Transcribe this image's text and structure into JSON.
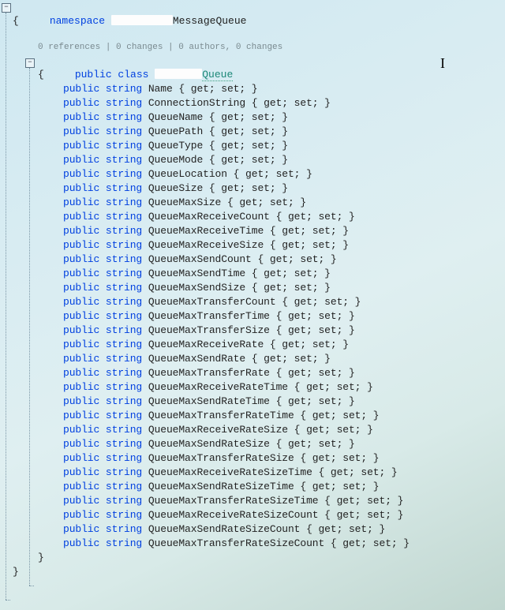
{
  "header": {
    "namespace_kw": "namespace",
    "namespace_suffix": "MessageQueue"
  },
  "codelens": {
    "text": "0 references | 0 changes | 0 authors, 0 changes"
  },
  "classline": {
    "modifiers": "public class",
    "name_suffix": "Queue"
  },
  "braces": {
    "open": "{",
    "close": "}"
  },
  "property_template": {
    "prefix": "public string ",
    "suffix": " { get; set; }"
  },
  "properties": [
    "Name",
    "ConnectionString",
    "QueueName",
    "QueuePath",
    "QueueType",
    "QueueMode",
    "QueueLocation",
    "QueueSize",
    "QueueMaxSize",
    "QueueMaxReceiveCount",
    "QueueMaxReceiveTime",
    "QueueMaxReceiveSize",
    "QueueMaxSendCount",
    "QueueMaxSendTime",
    "QueueMaxSendSize",
    "QueueMaxTransferCount",
    "QueueMaxTransferTime",
    "QueueMaxTransferSize",
    "QueueMaxReceiveRate",
    "QueueMaxSendRate",
    "QueueMaxTransferRate",
    "QueueMaxReceiveRateTime",
    "QueueMaxSendRateTime",
    "QueueMaxTransferRateTime",
    "QueueMaxReceiveRateSize",
    "QueueMaxSendRateSize",
    "QueueMaxTransferRateSize",
    "QueueMaxReceiveRateSizeTime",
    "QueueMaxSendRateSizeTime",
    "QueueMaxTransferRateSizeTime",
    "QueueMaxReceiveRateSizeCount",
    "QueueMaxSendRateSizeCount",
    "QueueMaxTransferRateSizeCount"
  ]
}
